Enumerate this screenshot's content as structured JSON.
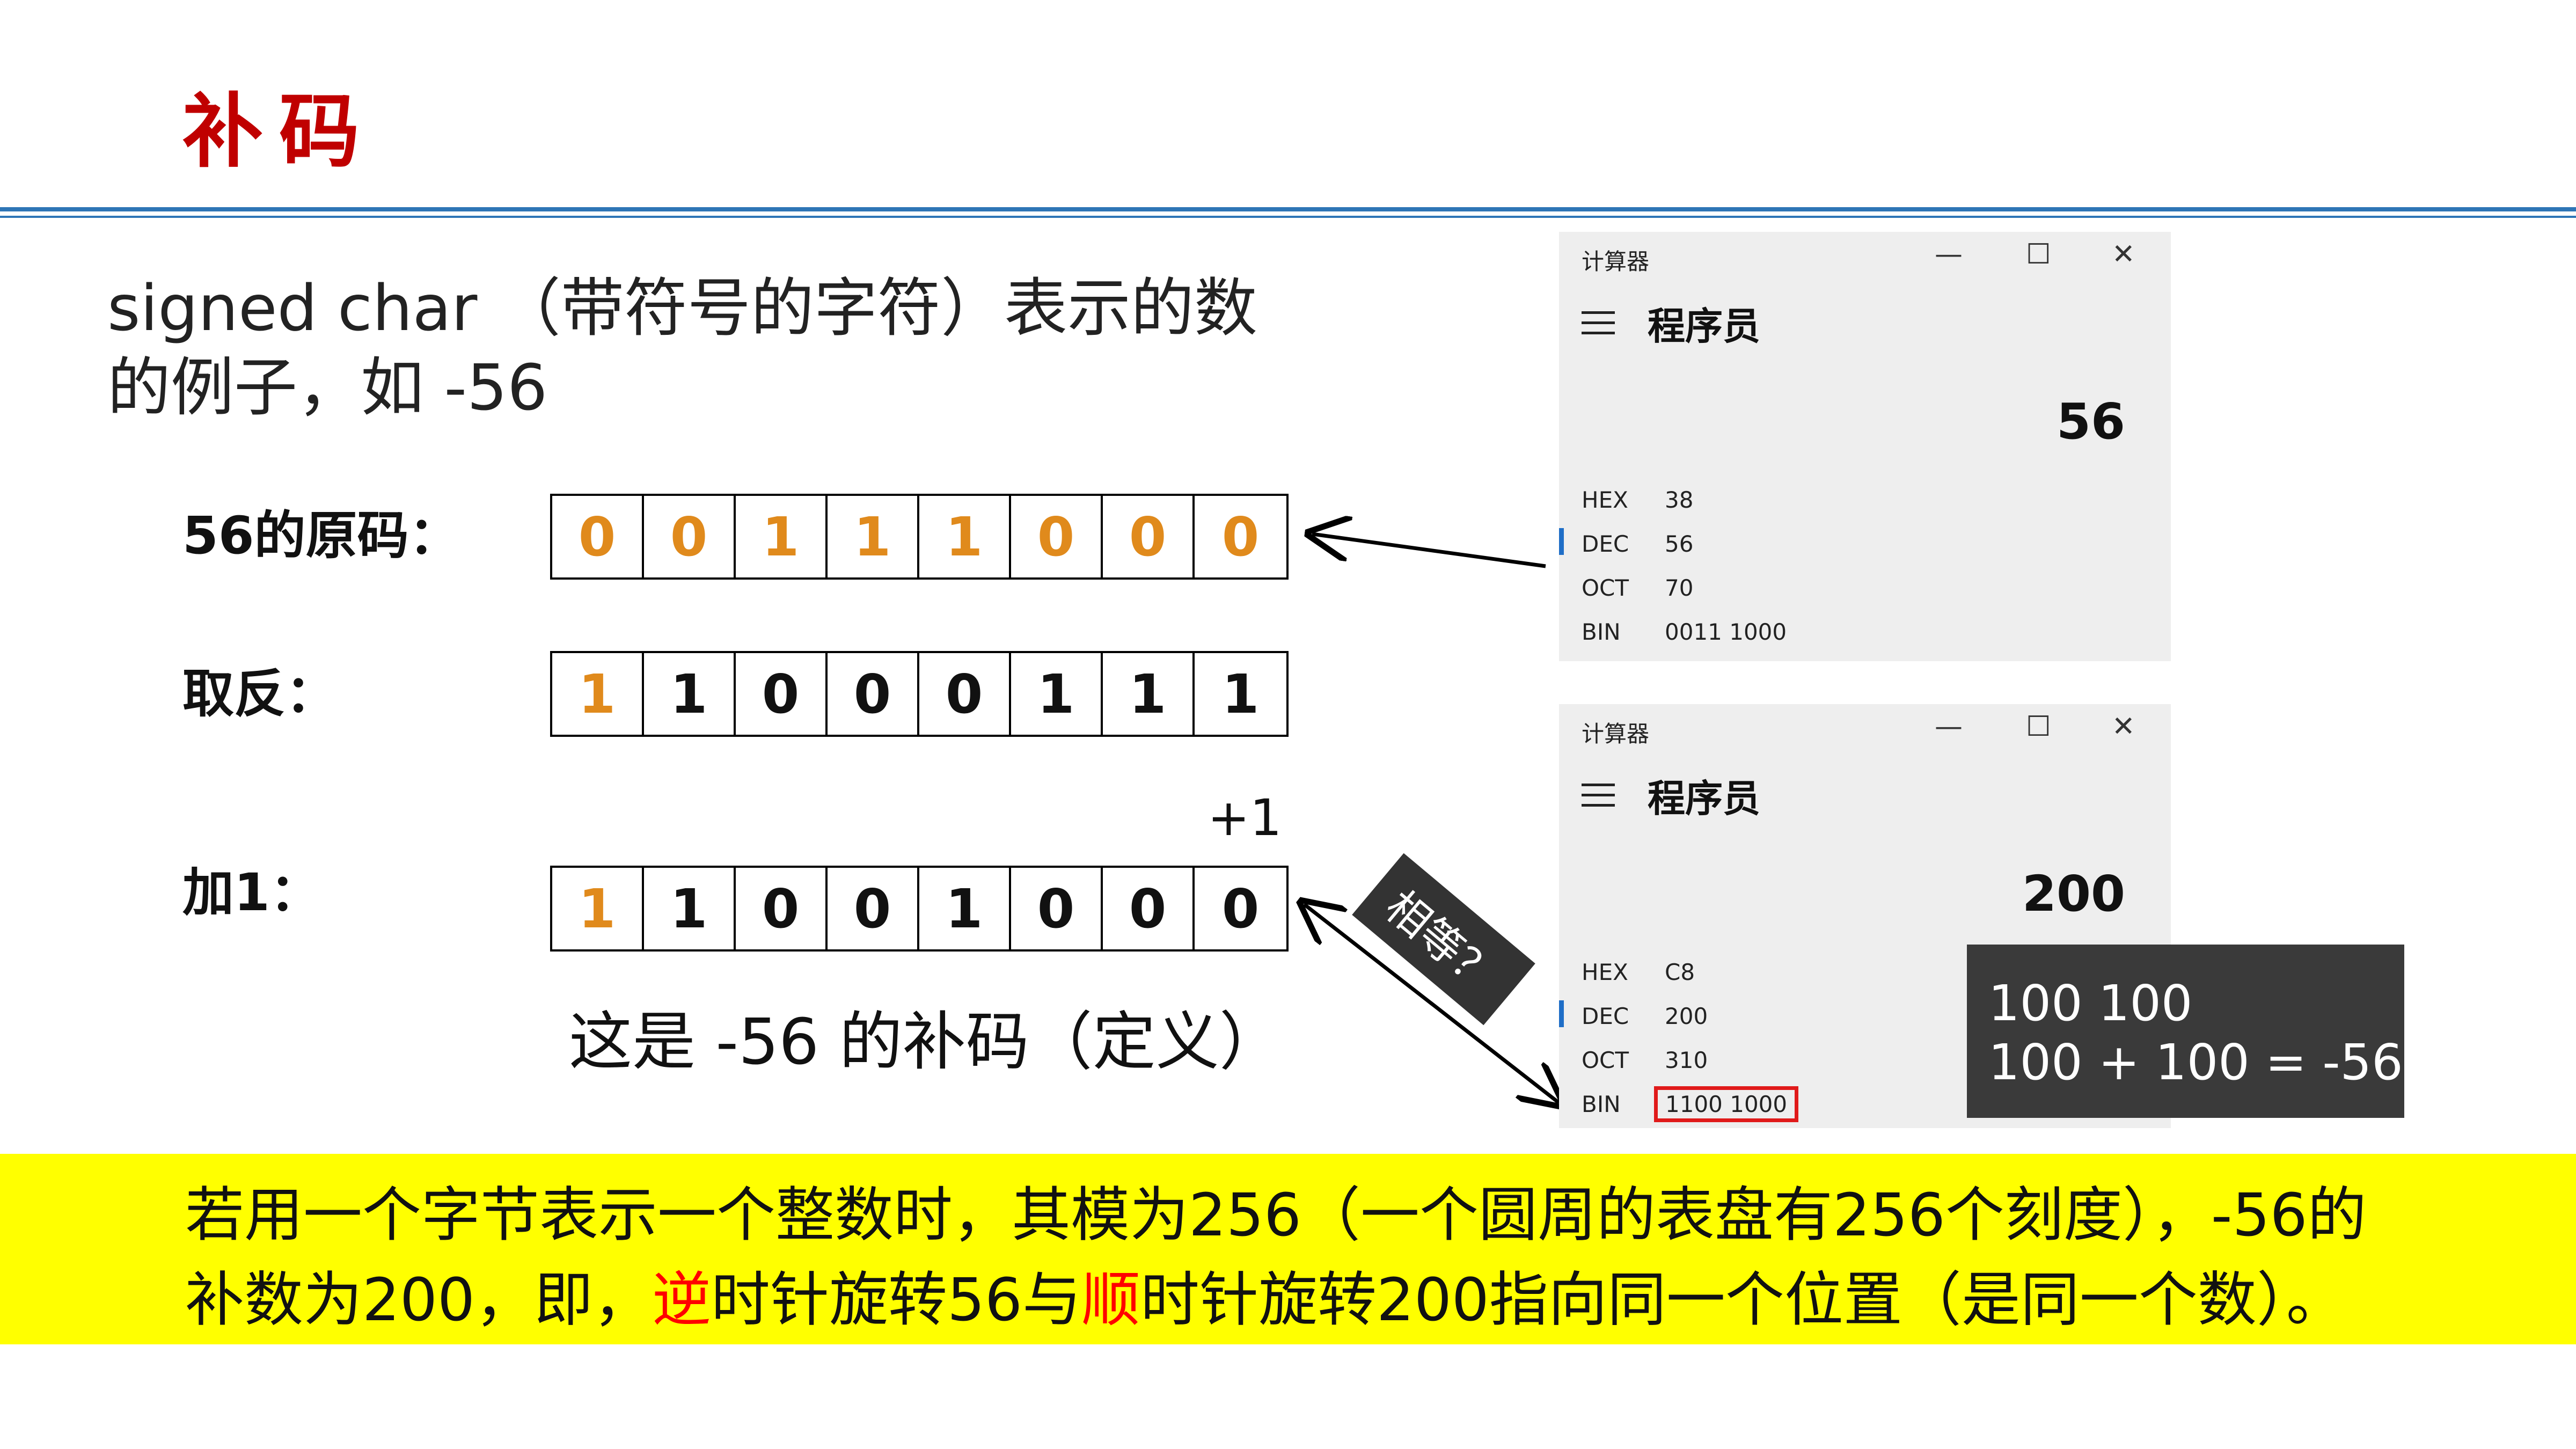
{
  "title": "补码",
  "intro": {
    "line1": "signed char （带符号的字符）表示的数",
    "line2": "的例子，如 -56"
  },
  "rows": [
    {
      "label": "56的原码：",
      "bits": [
        "0",
        "0",
        "1",
        "1",
        "1",
        "0",
        "0",
        "0"
      ],
      "orange": [
        true,
        true,
        true,
        true,
        true,
        true,
        true,
        true
      ]
    },
    {
      "label": "取反：",
      "bits": [
        "1",
        "1",
        "0",
        "0",
        "0",
        "1",
        "1",
        "1"
      ],
      "orange": [
        true,
        false,
        false,
        false,
        false,
        false,
        false,
        false
      ]
    },
    {
      "label": "加1：",
      "bits": [
        "1",
        "1",
        "0",
        "0",
        "1",
        "0",
        "0",
        "0"
      ],
      "orange": [
        true,
        false,
        false,
        false,
        false,
        false,
        false,
        false
      ]
    }
  ],
  "plus_one": "+1",
  "caption": "这是 -56 的补码（定义）",
  "tag": "相等？",
  "calculators": [
    {
      "title": "计算器",
      "mode": "程序员",
      "display": "56",
      "bases": [
        {
          "name": "HEX",
          "value": "38"
        },
        {
          "name": "DEC",
          "value": "56"
        },
        {
          "name": "OCT",
          "value": "70"
        },
        {
          "name": "BIN",
          "value": "0011 1000"
        }
      ]
    },
    {
      "title": "计算器",
      "mode": "程序员",
      "display": "200",
      "bases": [
        {
          "name": "HEX",
          "value": "C8"
        },
        {
          "name": "DEC",
          "value": "200"
        },
        {
          "name": "OCT",
          "value": "310"
        },
        {
          "name": "BIN",
          "value": "1100 1000"
        }
      ]
    }
  ],
  "window_controls": {
    "minimize": "—",
    "maximize": "☐",
    "close": "✕"
  },
  "note": {
    "line1": "100 100",
    "line2": "100 + 100 = -56"
  },
  "banner": {
    "line1": "若用一个字节表示一个整数时，其模为256（一个圆周的表盘有256个刻度），-56的",
    "line2_a": "补数为200，即，",
    "line2_red1": "逆",
    "line2_b": "时针旋转56与",
    "line2_red2": "顺",
    "line2_c": "时针旋转200指向同一个位置（是同一个数）。"
  },
  "colors": {
    "title": "#c00000",
    "rule": "#2e75b6",
    "bit_orange": "#e08a1c",
    "banner": "#ffff00",
    "dec_marker": "#1f6ec7",
    "bin_highlight": "#e01a1a"
  }
}
